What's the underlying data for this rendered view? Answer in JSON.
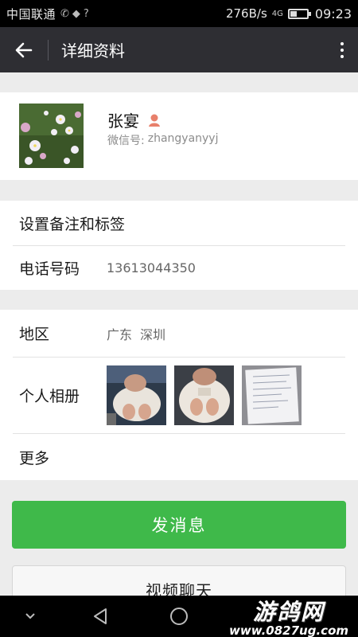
{
  "status_bar": {
    "carrier": "中国联通",
    "speed": "276B/s",
    "network": "4G",
    "battery_level": 0.35,
    "time": "09:23"
  },
  "header": {
    "back_icon": "arrow-left-icon",
    "title": "详细资料",
    "more_icon": "more-vertical-icon"
  },
  "profile": {
    "name": "张宴",
    "gender_icon": "female-icon",
    "wechat_id_label": "微信号:",
    "wechat_id": "zhangyanyyj"
  },
  "section_contact": {
    "remark_label": "设置备注和标签",
    "phone_label": "电话号码",
    "phone_value": "13613044350"
  },
  "section_info": {
    "region_label": "地区",
    "region_province": "广东",
    "region_city": "深圳",
    "album_label": "个人相册",
    "album_count": 3,
    "more_label": "更多"
  },
  "actions": {
    "send_message": "发消息",
    "video_chat": "视频聊天"
  },
  "nav": {
    "down_icon": "chevron-down-icon",
    "back_icon": "triangle-back-icon",
    "home_icon": "circle-home-icon"
  },
  "watermark": {
    "title": "游鸽网",
    "url": "www.0827ug.com"
  },
  "colors": {
    "accent_green": "#3fb94a",
    "appbar": "#2e2e33",
    "statusbar": "#000000"
  }
}
